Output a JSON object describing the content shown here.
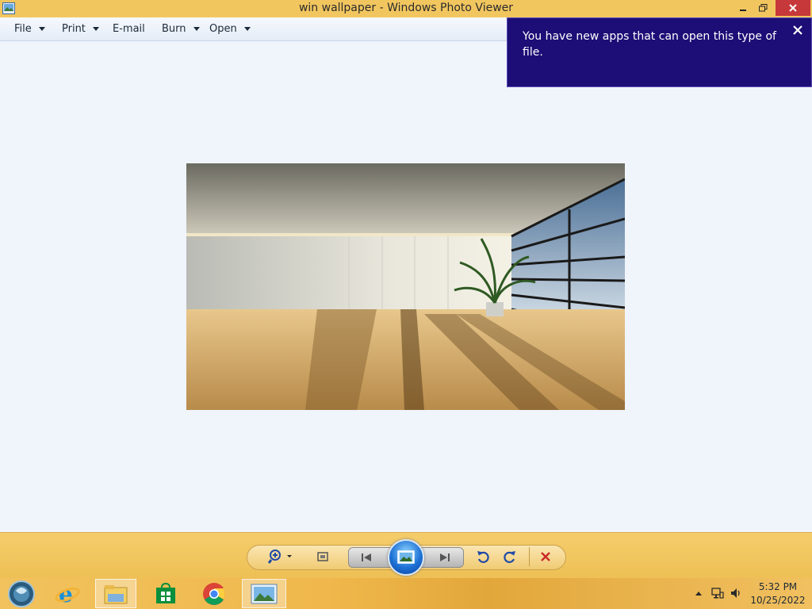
{
  "window": {
    "title": "win wallpaper - Windows Photo Viewer",
    "accent": "#f2c65f",
    "close_color": "#c7383a"
  },
  "menu": {
    "items": [
      {
        "label": "File",
        "has_dropdown": true
      },
      {
        "label": "Print",
        "has_dropdown": true
      },
      {
        "label": "E-mail",
        "has_dropdown": false
      },
      {
        "label": "Burn",
        "has_dropdown": true
      },
      {
        "label": "Open",
        "has_dropdown": true
      }
    ]
  },
  "notification": {
    "message": "You have new apps that can open this type of file.",
    "background": "#1d0d76",
    "close_icon": "close-icon"
  },
  "photo": {
    "icon": "image-wallpaper"
  },
  "controls": {
    "icons": [
      "zoom-icon",
      "actual-size-icon",
      "previous-icon",
      "slideshow-icon",
      "next-icon",
      "rotate-counterclockwise-icon",
      "rotate-clockwise-icon",
      "delete-icon"
    ]
  },
  "taskbar": {
    "apps": [
      "start-orb-icon",
      "internet-explorer-icon",
      "file-explorer-icon",
      "store-icon",
      "chrome-icon",
      "photo-viewer-icon"
    ],
    "clock": {
      "time": "5:32 PM",
      "date": "10/25/2022"
    }
  }
}
